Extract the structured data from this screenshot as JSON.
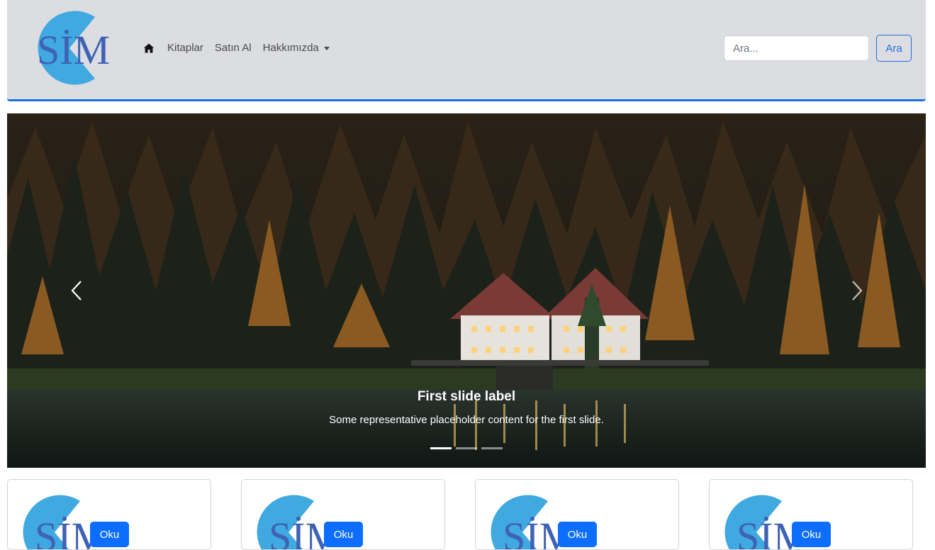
{
  "brand": {
    "logo_text": "SİM"
  },
  "nav": {
    "items": [
      {
        "label": "Kitaplar"
      },
      {
        "label": "Satın Al"
      },
      {
        "label": "Hakkımızda"
      }
    ]
  },
  "search": {
    "placeholder": "Ara...",
    "button_label": "Ara"
  },
  "carousel": {
    "slides": [
      {
        "title": "First slide label",
        "text": "Some representative placeholder content for the first slide."
      }
    ],
    "indicator_count": 3,
    "active_index": 0
  },
  "cards": [
    {
      "logo_text": "SİM",
      "button_label": "Oku"
    },
    {
      "logo_text": "SİM",
      "button_label": "Oku"
    },
    {
      "logo_text": "SİM",
      "button_label": "Oku"
    },
    {
      "logo_text": "SİM",
      "button_label": "Oku"
    }
  ],
  "colors": {
    "accent": "#1a6fe3",
    "navbar_bg": "#dcdde1",
    "logo_blue": "#3fa9e0",
    "logo_text": "#3f62b5",
    "card_button": "#0d6efd"
  }
}
